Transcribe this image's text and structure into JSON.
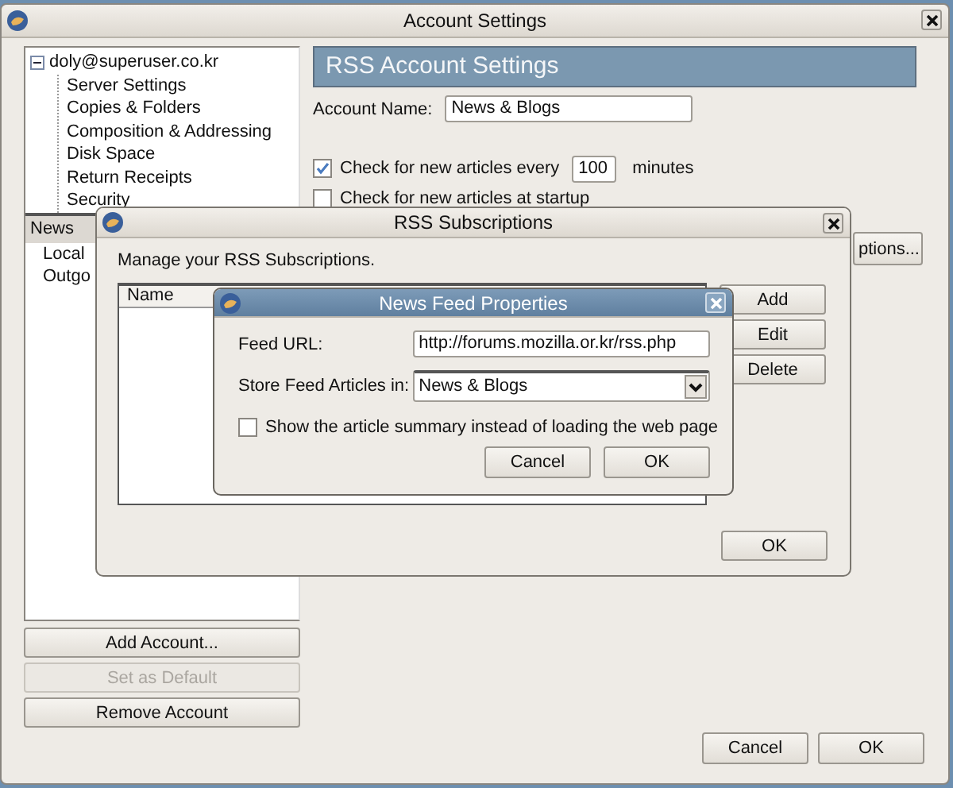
{
  "main_window": {
    "title": "Account Settings"
  },
  "account_tree": {
    "items": [
      {
        "label": "doly@superuser.co.kr",
        "expanded": true,
        "selected": false,
        "children": [
          {
            "label": "Server Settings",
            "selected": false
          },
          {
            "label": "Copies & Folders",
            "selected": false
          },
          {
            "label": "Composition & Addressing",
            "selected": false
          },
          {
            "label": "Disk Space",
            "selected": false
          },
          {
            "label": "Return Receipts",
            "selected": false
          },
          {
            "label": "Security",
            "selected": false
          }
        ]
      },
      {
        "label": "News",
        "selected": true
      },
      {
        "label": "Local",
        "selected": false
      },
      {
        "label": "Outgo",
        "selected": false
      }
    ]
  },
  "account_buttons": [
    {
      "label": "Add Account...",
      "disabled": false
    },
    {
      "label": "Set as Default",
      "disabled": true
    },
    {
      "label": "Remove Account",
      "disabled": false
    }
  ],
  "panel": {
    "header": "RSS Account Settings",
    "account_name_label": "Account Name:",
    "account_name_value": "News & Blogs",
    "check_every": {
      "checked": true,
      "label": "Check for new articles every",
      "value": "100",
      "unit": "minutes"
    },
    "check_startup": {
      "checked": false,
      "label": "Check for new articles at startup"
    },
    "subscriptions_button": "ptions..."
  },
  "dialog_buttons": [
    "Cancel",
    "OK"
  ],
  "rss_subscriptions": {
    "title": "RSS Subscriptions",
    "intro": "Manage your RSS Subscriptions.",
    "column": "Name",
    "buttons": [
      "Add",
      "Edit",
      "Delete"
    ],
    "ok": "OK"
  },
  "feed_properties": {
    "title": "News Feed Properties",
    "url_label": "Feed URL:",
    "url_value": "http://forums.mozilla.or.kr/rss.php",
    "folder_label": "Store Feed Articles in:",
    "folder_value": "News & Blogs",
    "summary": {
      "checked": false,
      "label": "Show the article summary instead of loading the web page"
    },
    "buttons": [
      "Cancel",
      "OK"
    ]
  }
}
